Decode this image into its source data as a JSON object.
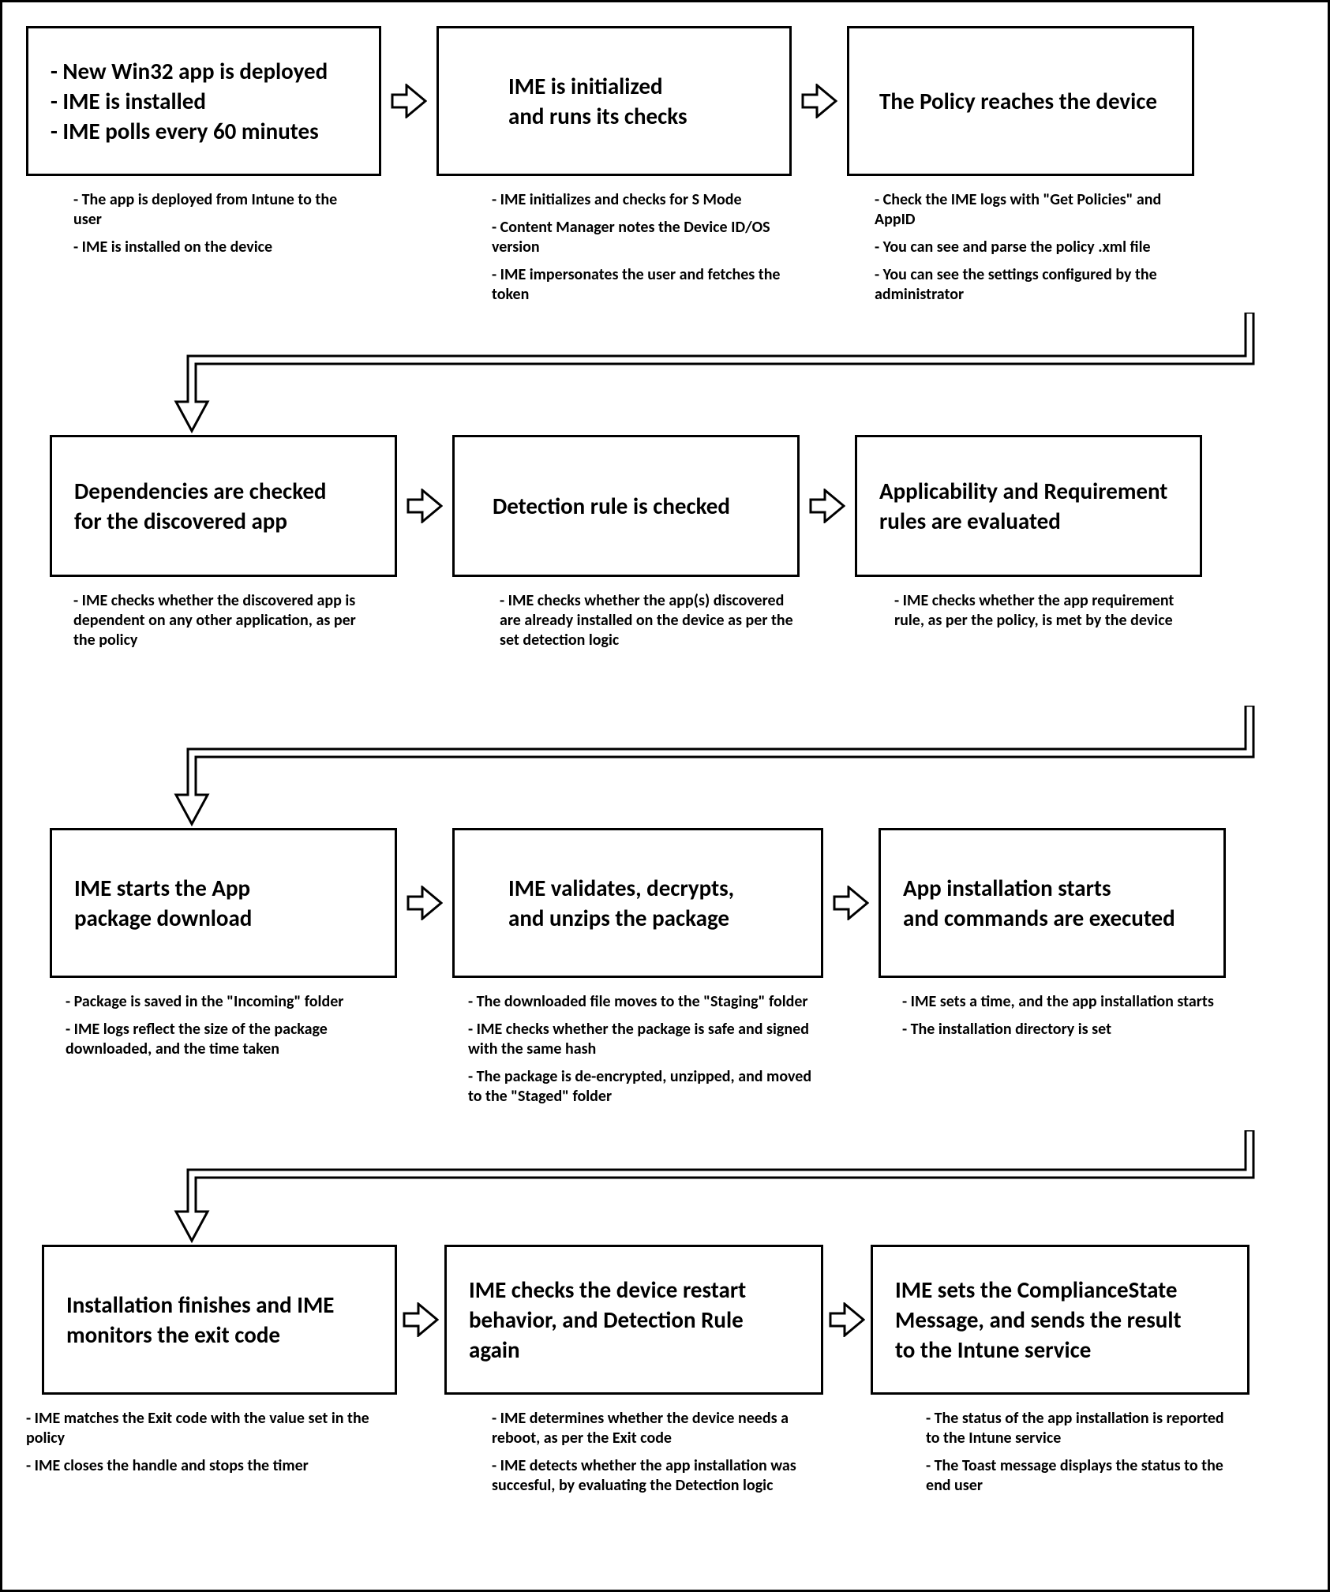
{
  "steps": [
    {
      "title_lines": [
        "- New Win32 app is deployed",
        "- IME is installed",
        "- IME polls every 60 minutes"
      ],
      "desc_lines": [
        "- The app is deployed from Intune to the user",
        "- IME is installed on the device"
      ]
    },
    {
      "title_lines": [
        "IME is initialized",
        "and runs its checks"
      ],
      "desc_lines": [
        "- IME initializes and checks for S Mode",
        "- Content Manager notes the Device ID/OS version",
        "- IME impersonates the user and fetches the token"
      ]
    },
    {
      "title_lines": [
        "The Policy reaches the device"
      ],
      "desc_lines": [
        "- Check the IME logs with \"Get Policies\" and AppID",
        "- You can see and parse the policy .xml file",
        "- You can see the settings configured by the administrator"
      ]
    },
    {
      "title_lines": [
        "Dependencies are checked",
        "for the discovered app"
      ],
      "desc_lines": [
        "- IME checks whether the discovered app is dependent on any other application, as per the policy"
      ]
    },
    {
      "title_lines": [
        "Detection rule is checked"
      ],
      "desc_lines": [
        "- IME checks whether the app(s) discovered are already installed on the device as per the set detection logic"
      ]
    },
    {
      "title_lines": [
        "Applicability and Requirement",
        "rules are evaluated"
      ],
      "desc_lines": [
        "- IME checks whether the app requirement rule, as per the policy, is met by the device"
      ]
    },
    {
      "title_lines": [
        "IME starts the App",
        "package download"
      ],
      "desc_lines": [
        "- Package is saved in the \"Incoming\" folder",
        "- IME logs reflect the size of the package downloaded, and the time taken"
      ]
    },
    {
      "title_lines": [
        "IME validates, decrypts,",
        "and unzips the package"
      ],
      "desc_lines": [
        "- The downloaded file moves to the \"Staging\" folder",
        "- IME checks whether the package is safe and signed with the same hash",
        "- The package is de-encrypted, unzipped, and moved to the \"Staged\" folder"
      ]
    },
    {
      "title_lines": [
        "App installation starts",
        "and commands are executed"
      ],
      "desc_lines": [
        "- IME sets a time, and the app installation starts",
        "- The installation directory is set"
      ]
    },
    {
      "title_lines": [
        "Installation finishes and IME",
        "monitors the exit code"
      ],
      "desc_lines": [
        "- IME matches the Exit code with the value set in the policy",
        "- IME closes the handle and stops the timer"
      ]
    },
    {
      "title_lines": [
        "IME checks the device restart",
        "behavior, and Detection Rule",
        "again"
      ],
      "desc_lines": [
        "- IME determines whether the device needs a reboot, as per the Exit code",
        "- IME detects whether the app installation was succesful, by evaluating the Detection logic"
      ]
    },
    {
      "title_lines": [
        "IME sets the ComplianceState",
        "Message, and sends the result",
        "to the Intune service"
      ],
      "desc_lines": [
        "- The status of the app installation is reported to the Intune service",
        "- The Toast message displays the status to the end user"
      ]
    }
  ]
}
